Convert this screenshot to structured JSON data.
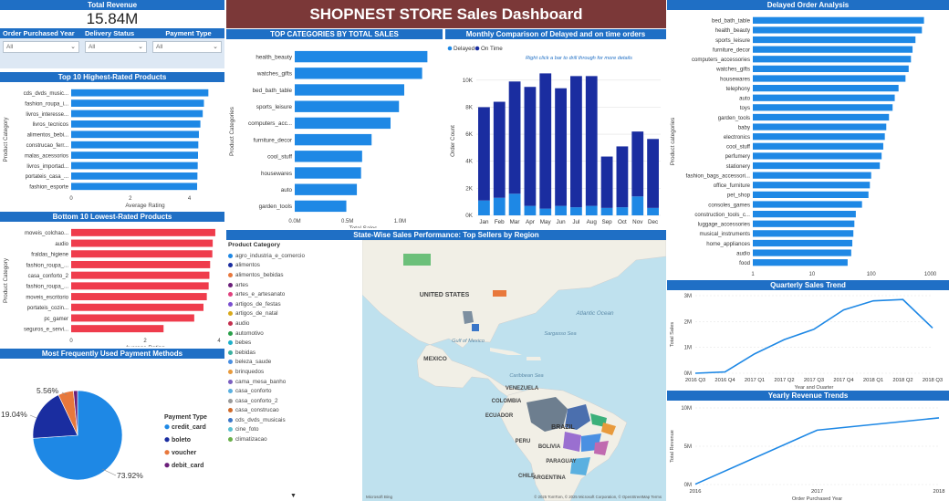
{
  "title": "SHOPNEST STORE Sales Dashboard",
  "total_revenue": {
    "label": "Total Revenue",
    "value": "15.84M"
  },
  "filters": [
    {
      "label": "Order Purchased Year",
      "value": "All"
    },
    {
      "label": "Delivery Status",
      "value": "All"
    },
    {
      "label": "Payment Type",
      "value": "All"
    }
  ],
  "colors": {
    "header": "#1f6fc5",
    "bar_blue": "#1e88e5",
    "bar_red": "#ef3c4c",
    "dark_blue": "#1a2da0",
    "title_bg": "#7b3838"
  },
  "top_rated": {
    "title": "Top 10 Highest-Rated Products",
    "ylabel": "Product Category",
    "xlabel": "Average Rating",
    "ticks": [
      "0",
      "2",
      "4"
    ],
    "chart_data": {
      "type": "bar",
      "categories": [
        "cds_dvds_music...",
        "fashion_roupa_i...",
        "livros_interesse...",
        "livros_tecnicos",
        "alimentos_bebi...",
        "construcao_ferr...",
        "malas_acessorios",
        "livros_importad...",
        "portateis_casa_...",
        "fashion_esporte"
      ],
      "values": [
        4.64,
        4.49,
        4.45,
        4.37,
        4.32,
        4.3,
        4.29,
        4.28,
        4.27,
        4.26
      ],
      "xlim": [
        0,
        5
      ]
    }
  },
  "bottom_rated": {
    "title": "Bottom 10 Lowest-Rated Products",
    "ylabel": "Product Category",
    "xlabel": "Average Rating",
    "ticks": [
      "0",
      "2",
      "4"
    ],
    "chart_data": {
      "type": "bar",
      "categories": [
        "moveis_colchao...",
        "audio",
        "fraldas_higiene",
        "fashion_roupa_...",
        "casa_conforto_2",
        "fashion_roupa_...",
        "moveis_escritorio",
        "portateis_cozin...",
        "pc_gamer",
        "seguros_e_servi..."
      ],
      "values": [
        3.9,
        3.83,
        3.82,
        3.76,
        3.74,
        3.72,
        3.67,
        3.58,
        3.33,
        2.5
      ],
      "xlim": [
        0,
        4
      ]
    }
  },
  "payment": {
    "title": "Most Frequently Used Payment Methods",
    "legend_title": "Payment Type",
    "chart_data": {
      "type": "pie",
      "labels": [
        "credit_card",
        "boleto",
        "voucher",
        "debit_card"
      ],
      "values": [
        73.92,
        19.04,
        5.56,
        1.48
      ],
      "colors": [
        "#1e88e5",
        "#1a2da0",
        "#e8783c",
        "#6b1f7a"
      ],
      "data_labels": [
        "73.92%",
        "19.04%",
        "5.56%",
        ""
      ]
    }
  },
  "top_categories": {
    "title": "TOP CATEGORIES BY TOTAL SALES",
    "ylabel": "Product Categories",
    "xlabel": "Total Sales",
    "ticks": [
      "0.0M",
      "0.5M",
      "1.0M"
    ],
    "chart_data": {
      "type": "bar",
      "categories": [
        "health_beauty",
        "watches_gifts",
        "bed_bath_table",
        "sports_leisure",
        "computers_acc...",
        "furniture_decor",
        "cool_stuff",
        "housewares",
        "auto",
        "garden_tools"
      ],
      "values": [
        1.26,
        1.21,
        1.04,
        0.99,
        0.91,
        0.73,
        0.64,
        0.63,
        0.59,
        0.49
      ],
      "xlim": [
        0,
        1.3
      ]
    }
  },
  "monthly": {
    "title": "Monthly Comparison of Delayed and on time orders",
    "legend": [
      "Delayed",
      "On Time"
    ],
    "ylabel": "Order Count",
    "tooltip": "Right click a bar to drill through for more details",
    "yticks": [
      "0K",
      "2K",
      "4K",
      "6K",
      "8K",
      "10K"
    ],
    "chart_data": {
      "type": "bar",
      "stacked": true,
      "categories": [
        "Jan",
        "Feb",
        "Mar",
        "Apr",
        "May",
        "Jun",
        "Jul",
        "Aug",
        "Sep",
        "Oct",
        "Nov",
        "Dec"
      ],
      "series": [
        {
          "name": "Delayed",
          "values": [
            1100,
            1300,
            1600,
            700,
            500,
            700,
            600,
            700,
            550,
            600,
            1400,
            550
          ]
        },
        {
          "name": "On Time",
          "values": [
            6900,
            7100,
            8300,
            8800,
            10000,
            8700,
            9700,
            9600,
            3800,
            4500,
            4800,
            5100
          ]
        }
      ],
      "ylim": [
        0,
        11000
      ]
    }
  },
  "delayed": {
    "title": "Delayed Order Analysis",
    "ylabel": "Product categories",
    "xlabel": "Delayed Orders",
    "ticks": [
      "1",
      "10",
      "100",
      "1000"
    ],
    "chart_data": {
      "type": "bar",
      "xscale": "log",
      "categories": [
        "bed_bath_table",
        "health_beauty",
        "sports_leisure",
        "furniture_decor",
        "computers_accessories",
        "watches_gifts",
        "housewares",
        "telephony",
        "auto",
        "toys",
        "garden_tools",
        "baby",
        "electronics",
        "cool_stuff",
        "perfumery",
        "stationery",
        "fashion_bags_accessori...",
        "office_furniture",
        "pet_shop",
        "consoles_games",
        "construction_tools_c...",
        "luggage_accessories",
        "musical_instruments",
        "home_appliances",
        "audio",
        "food"
      ],
      "values": [
        780,
        720,
        560,
        500,
        470,
        430,
        380,
        290,
        250,
        230,
        200,
        180,
        170,
        160,
        150,
        140,
        100,
        95,
        90,
        70,
        55,
        52,
        50,
        48,
        46,
        40
      ],
      "xlim": [
        1,
        1500
      ]
    }
  },
  "quarterly": {
    "title": "Quarterly Sales Trend",
    "ylabel": "Total Sales",
    "xlabel": "Year and Quarter",
    "yticks": [
      "0M",
      "1M",
      "2M",
      "3M"
    ],
    "chart_data": {
      "type": "line",
      "x": [
        "2016 Q3",
        "2016 Q4",
        "2017 Q1",
        "2017 Q2",
        "2017 Q3",
        "2017 Q4",
        "2018 Q1",
        "2018 Q2",
        "2018 Q3"
      ],
      "values": [
        0.0,
        0.05,
        0.75,
        1.3,
        1.7,
        2.45,
        2.8,
        2.85,
        1.75
      ],
      "ylim": [
        0,
        3
      ]
    }
  },
  "yearly": {
    "title": "Yearly Revenue Trends",
    "ylabel": "Total Revenue",
    "xlabel": "Order Purchased Year",
    "yticks": [
      "0M",
      "5M",
      "10M"
    ],
    "chart_data": {
      "type": "line",
      "x": [
        "2016",
        "2017",
        "2018"
      ],
      "values": [
        0.05,
        7.1,
        8.7
      ],
      "ylim": [
        0,
        10
      ]
    }
  },
  "map": {
    "title": "State-Wise Sales Performance: Top Sellers by Region",
    "legend_title": "Product Category",
    "legend_items": [
      "agro_industria_e_comercio",
      "alimentos",
      "alimentos_bebidas",
      "artes",
      "artes_e_artesanato",
      "artigos_de_festas",
      "artigos_de_natal",
      "audio",
      "automotivo",
      "bebes",
      "bebidas",
      "beleza_saude",
      "brinquedos",
      "cama_mesa_banho",
      "casa_conforto",
      "casa_conforto_2",
      "casa_construcao",
      "cds_dvds_musicais",
      "cine_foto",
      "climatizacao"
    ],
    "legend_colors": [
      "#1e88e5",
      "#1a2da0",
      "#e8783c",
      "#6b1f7a",
      "#e0417e",
      "#7a4fd0",
      "#d9a91a",
      "#c42f4e",
      "#2aa04a",
      "#1fb0c9",
      "#3bb0a0",
      "#4a90e2",
      "#e89a3c",
      "#7b5fc0",
      "#5ab0e0",
      "#9a9a9a",
      "#d06a2a",
      "#3a76c8",
      "#5ac0d0",
      "#6ab04a"
    ],
    "labels": {
      "us": "UNITED STATES",
      "mexico": "MEXICO",
      "brazil": "BRAZIL",
      "peru": "PERU",
      "bolivia": "BOLIVIA",
      "venezuela": "VENEZUELA",
      "colombia": "COLOMBIA",
      "ecuador": "ECUADOR",
      "chile": "CHILE",
      "argentina": "ARGENTINA",
      "paraguay": "PARAGUAY",
      "atlantic": "Atlantic Ocean",
      "gulf": "Gulf of Mexico",
      "sargasso": "Sargasso Sea",
      "caribbean": "Caribbean Sea"
    },
    "attribution": "© 2025 TomTom, © 2025 Microsoft Corporation, © OpenStreetMap Terms",
    "brand": "Microsoft Bing"
  }
}
